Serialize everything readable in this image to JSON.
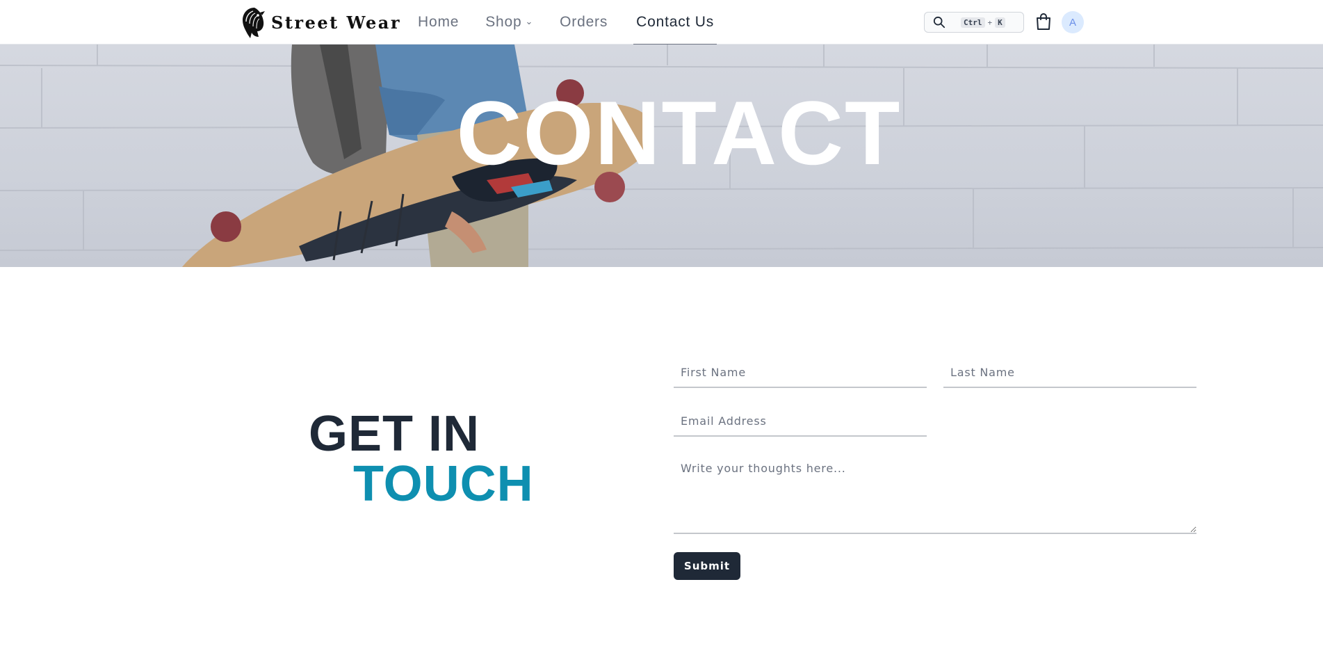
{
  "brand": {
    "name": "Street Wear",
    "logo_icon": "eagle-head-icon"
  },
  "nav": {
    "items": [
      {
        "label": "Home"
      },
      {
        "label": "Shop",
        "chevron": "⌄"
      },
      {
        "label": "Orders"
      },
      {
        "label": "Contact Us",
        "active": true
      }
    ]
  },
  "search": {
    "icon": "search-icon",
    "shortcut_key1": "Ctrl",
    "shortcut_plus": "+",
    "shortcut_key2": "K"
  },
  "cart": {
    "icon": "shopping-bag-icon"
  },
  "user": {
    "avatar_initial": "A"
  },
  "hero": {
    "title": "CONTACT"
  },
  "contact": {
    "heading_line1": "GET IN",
    "heading_line2": "TOUCH",
    "first_name_placeholder": "First Name",
    "last_name_placeholder": "Last Name",
    "email_placeholder": "Email Address",
    "message_placeholder": "Write your thoughts here...",
    "submit_label": "Submit"
  },
  "colors": {
    "primary_dark": "#1f2937",
    "accent": "#0e8fb0",
    "avatar_bg": "#dbeafe",
    "avatar_text": "#6b8fe8"
  }
}
